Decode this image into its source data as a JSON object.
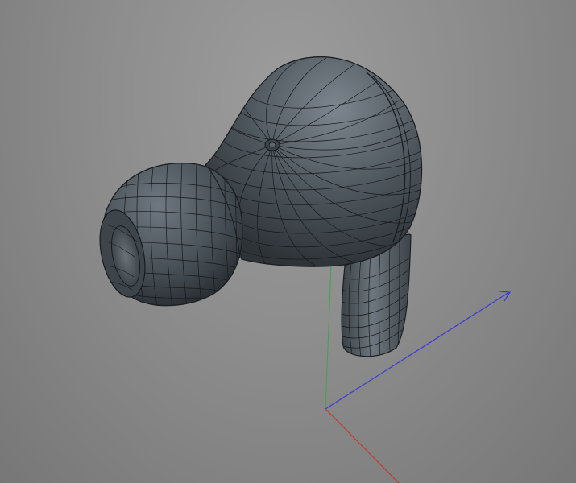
{
  "viewport": {
    "background_color": "#8f8f8f",
    "object": "earbud-mesh",
    "render_mode": "shaded-wireframe"
  },
  "colors": {
    "mesh_fill": "#4a5259",
    "mesh_highlight": "#7d868e",
    "mesh_shadow": "#2b3035",
    "wire": "#15191c",
    "axis_x": "#c0392b",
    "axis_y": "#3fa34d",
    "axis_z": "#3b3bd6"
  },
  "axes": [
    "x-axis",
    "y-axis",
    "z-axis"
  ]
}
